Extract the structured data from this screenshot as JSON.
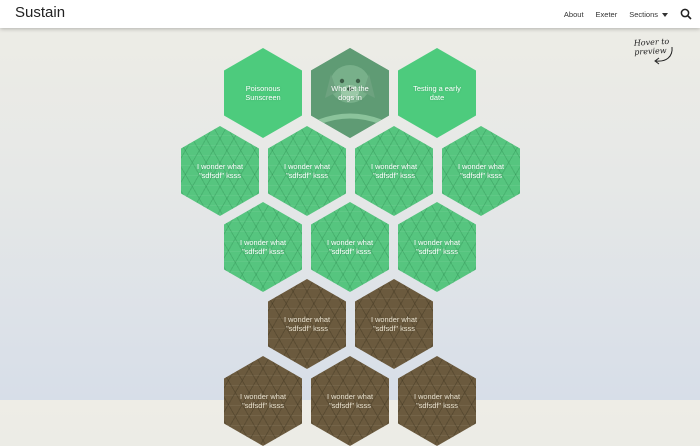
{
  "navbar": {
    "brand": "Sustain",
    "links": [
      "About",
      "Exeter",
      "Sections"
    ]
  },
  "hint": "Hover to preview",
  "icons": {
    "search": "search-icon",
    "dropdown": "caret-down-icon",
    "arrow": "curved-arrow-icon"
  },
  "colors": {
    "green": "#4dcb7d",
    "pattern_green": "#56c57f",
    "brown": "#6b5a3e",
    "text": "#ffffff"
  },
  "tiles": [
    {
      "label": "Poisonous Sunscreen"
    },
    {
      "label": "Who let the dogs in"
    },
    {
      "label": "Testing a early date"
    },
    {
      "label": "I wonder what \"sdfsdf\" ksss"
    },
    {
      "label": "I wonder what \"sdfsdf\" ksss"
    },
    {
      "label": "I wonder what \"sdfsdf\" ksss"
    },
    {
      "label": "I wonder what \"sdfsdf\" ksss"
    },
    {
      "label": "I wonder what \"sdfsdf\" ksss"
    },
    {
      "label": "I wonder what \"sdfsdf\" ksss"
    },
    {
      "label": "I wonder what \"sdfsdf\" ksss"
    },
    {
      "label": "I wonder what \"sdfsdf\" ksss"
    },
    {
      "label": "I wonder what \"sdfsdf\" ksss"
    },
    {
      "label": "I wonder what \"sdfsdf\" ksss"
    },
    {
      "label": "I wonder what \"sdfsdf\" ksss"
    },
    {
      "label": "I wonder what \"sdfsdf\" ksss"
    }
  ]
}
